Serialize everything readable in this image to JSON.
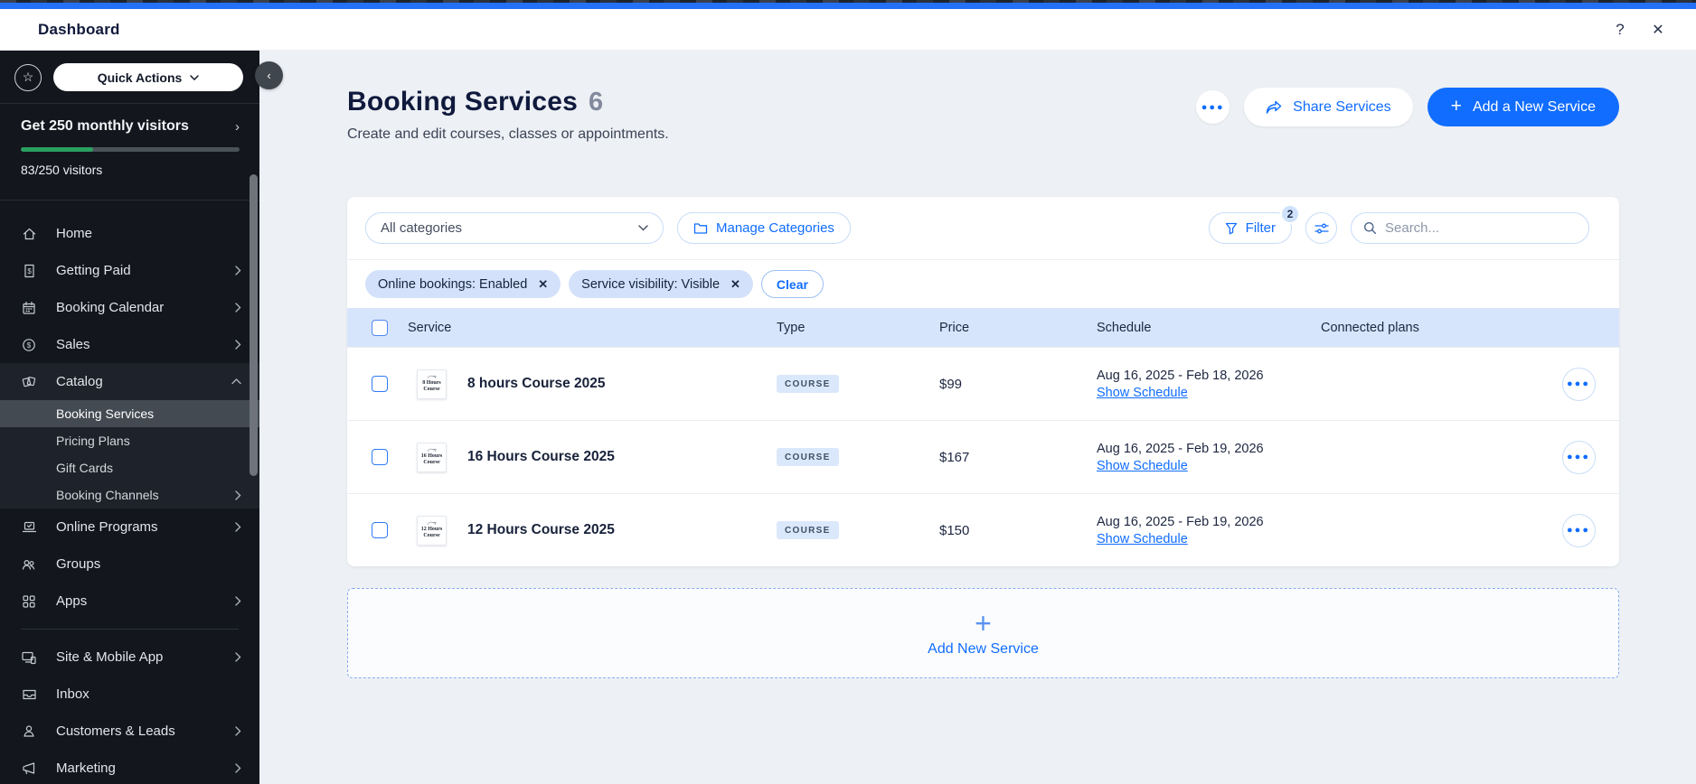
{
  "window": {
    "title": "Dashboard",
    "help_icon": "question-mark",
    "close_icon": "close-x"
  },
  "sidebar": {
    "quick_actions_label": "Quick Actions",
    "promo_title": "Get 250 monthly visitors",
    "promo_progress_label": "83/250 visitors",
    "promo_progress_pct": 33,
    "menu": [
      {
        "label": "Home",
        "icon": "home"
      },
      {
        "label": "Getting Paid",
        "icon": "getting-paid",
        "chevron": "right"
      },
      {
        "label": "Booking Calendar",
        "icon": "calendar",
        "chevron": "right"
      },
      {
        "label": "Sales",
        "icon": "sales",
        "chevron": "right"
      },
      {
        "label": "Catalog",
        "icon": "catalog",
        "chevron": "up",
        "expanded": true,
        "children": [
          {
            "label": "Booking Services",
            "selected": true
          },
          {
            "label": "Pricing Plans"
          },
          {
            "label": "Gift Cards"
          },
          {
            "label": "Booking Channels",
            "chevron": "right"
          }
        ]
      },
      {
        "label": "Online Programs",
        "icon": "online-programs",
        "chevron": "right"
      },
      {
        "label": "Groups",
        "icon": "groups"
      },
      {
        "label": "Apps",
        "icon": "apps",
        "chevron": "right"
      },
      {
        "label": "Site & Mobile App",
        "icon": "site-mobile",
        "chevron": "right",
        "divider_before": true
      },
      {
        "label": "Inbox",
        "icon": "inbox"
      },
      {
        "label": "Customers & Leads",
        "icon": "customers",
        "chevron": "right"
      },
      {
        "label": "Marketing",
        "icon": "marketing",
        "chevron": "right"
      }
    ]
  },
  "page": {
    "title": "Booking Services",
    "count": "6",
    "subtitle": "Create and edit courses, classes or appointments.",
    "share_button": "Share Services",
    "add_button": "Add a New Service"
  },
  "toolbar": {
    "category_select": "All categories",
    "manage_categories_button": "Manage Categories",
    "filter_button": "Filter",
    "filter_badge": "2",
    "search_placeholder": "Search..."
  },
  "filter_chips": {
    "chips": [
      {
        "label": "Online bookings: Enabled"
      },
      {
        "label": "Service visibility: Visible"
      }
    ],
    "clear_button": "Clear"
  },
  "table": {
    "columns": [
      "Service",
      "Type",
      "Price",
      "Schedule",
      "Connected plans"
    ],
    "rows": [
      {
        "title": "8 hours Course 2025",
        "thumb_line1": "8 Hours",
        "thumb_line2": "Course",
        "type": "COURSE",
        "price": "$99",
        "schedule": "Aug 16, 2025 - Feb 18, 2026",
        "schedule_link": "Show Schedule",
        "connected_plans": ""
      },
      {
        "title": "16 Hours Course 2025",
        "thumb_line1": "16 Hours",
        "thumb_line2": "Course",
        "type": "COURSE",
        "price": "$167",
        "schedule": "Aug 16, 2025 - Feb 19, 2026",
        "schedule_link": "Show Schedule",
        "connected_plans": ""
      },
      {
        "title": "12 Hours Course 2025",
        "thumb_line1": "12 Hours",
        "thumb_line2": "Course",
        "type": "COURSE",
        "price": "$150",
        "schedule": "Aug 16, 2025 - Feb 19, 2026",
        "schedule_link": "Show Schedule",
        "connected_plans": ""
      }
    ]
  },
  "add_new_service_label": "Add New Service",
  "colors": {
    "accent_blue": "#116dff",
    "topbar_blue": "#2471f9",
    "header_band": "#d7e5fc",
    "chip_bg": "#d3e2fa",
    "sidebar_bg": "#13161d",
    "progress_green": "#2aa060"
  }
}
